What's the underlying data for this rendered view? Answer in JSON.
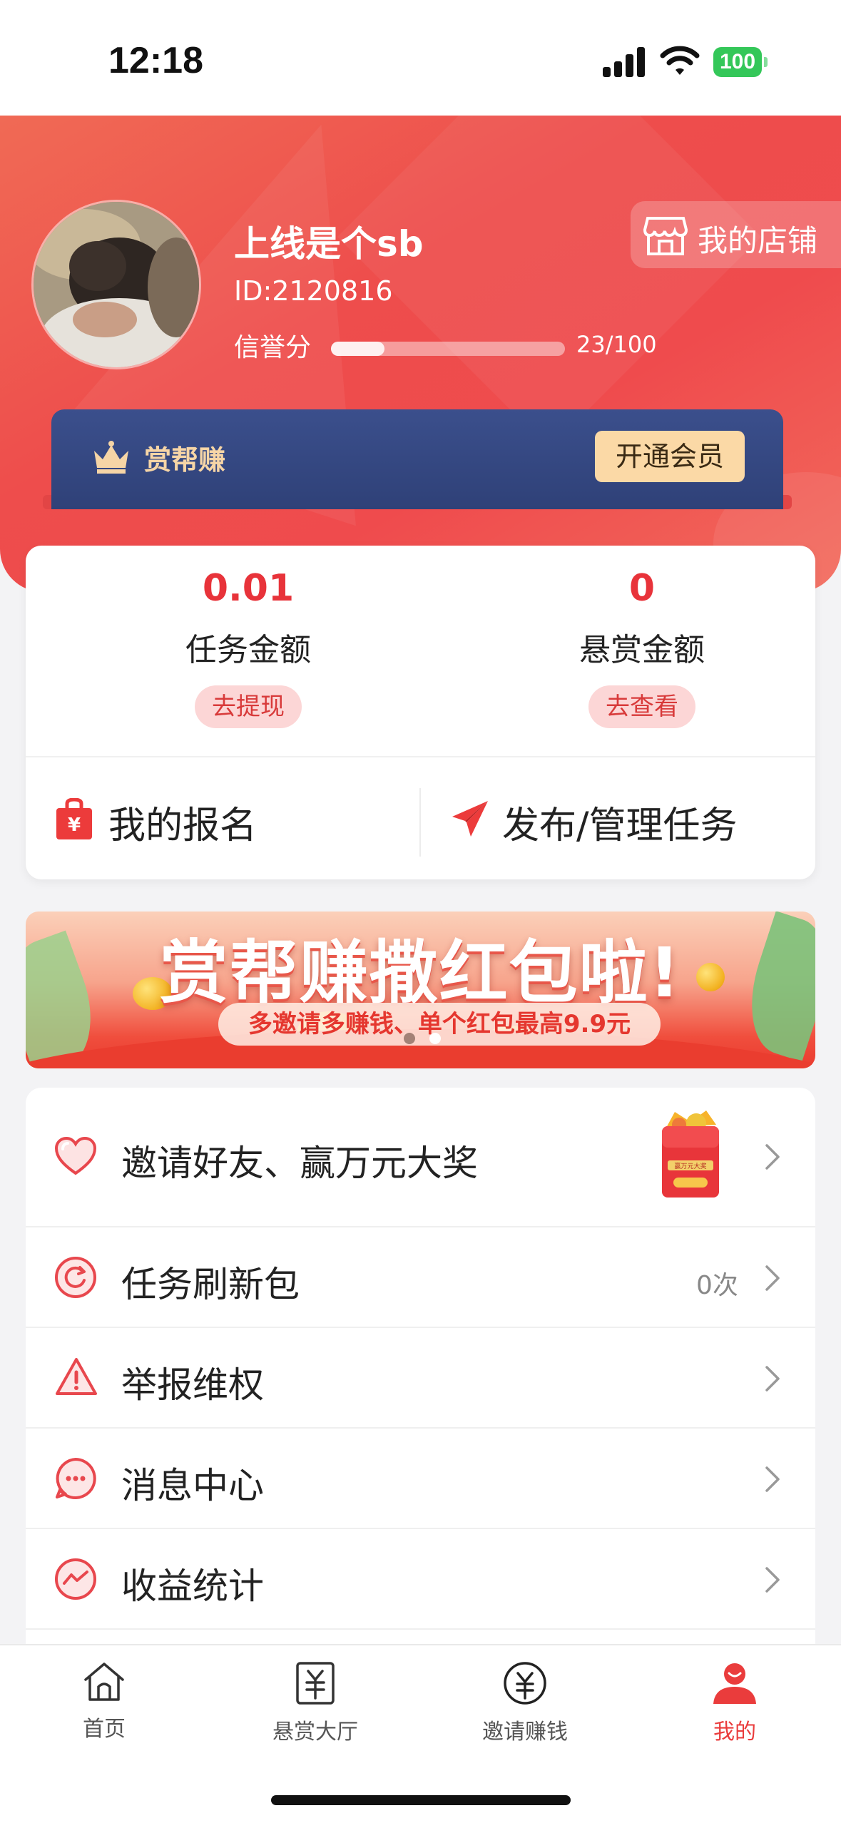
{
  "status_bar": {
    "time": "12:18",
    "battery": "100"
  },
  "profile": {
    "username": "上线是个sb",
    "user_id": "ID:2120816",
    "credit_label": "信誉分",
    "credit_score": 23,
    "credit_max": 100,
    "credit_text": "23/100",
    "shop_button": "我的店铺"
  },
  "vip": {
    "title": "赏帮赚",
    "button": "开通会员"
  },
  "stats": {
    "task_amount": {
      "value": "0.01",
      "label": "任务金额",
      "button": "去提现"
    },
    "reward_amount": {
      "value": "0",
      "label": "悬赏金额",
      "button": "去查看"
    }
  },
  "actions": {
    "my_signup": "我的报名",
    "publish_manage": "发布/管理任务"
  },
  "banner": {
    "title": "赏帮赚撒红包啦!",
    "subtitle": "多邀请多赚钱、单个红包最高9.9元",
    "slide_count": 2,
    "active_slide": 2
  },
  "menu": [
    {
      "label": "邀请好友、赢万元大奖",
      "icon": "heart-icon",
      "value": "",
      "promo_caption": "赢万元大奖"
    },
    {
      "label": "任务刷新包",
      "icon": "refresh-icon",
      "value": "0次"
    },
    {
      "label": "举报维权",
      "icon": "warning-icon",
      "value": ""
    },
    {
      "label": "消息中心",
      "icon": "message-icon",
      "value": ""
    },
    {
      "label": "收益统计",
      "icon": "chart-icon",
      "value": ""
    }
  ],
  "tabbar": [
    {
      "label": "首页",
      "icon": "home-icon",
      "active": false
    },
    {
      "label": "悬赏大厅",
      "icon": "yuan-card-icon",
      "active": false
    },
    {
      "label": "邀请赚钱",
      "icon": "yuan-circle-icon",
      "active": false
    },
    {
      "label": "我的",
      "icon": "user-icon",
      "active": true
    }
  ],
  "colors": {
    "primary_red": "#ee4d4c",
    "vip_blue": "#34477f",
    "gold": "#f6d5a6",
    "active_tab": "#ea3c3c"
  }
}
